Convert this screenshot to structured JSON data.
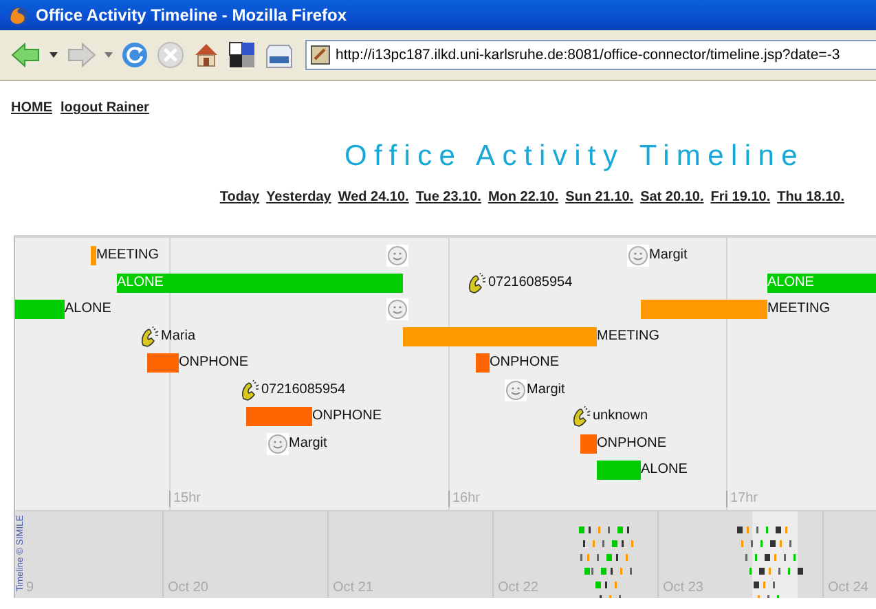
{
  "window": {
    "title": "Office Activity Timeline - Mozilla Firefox"
  },
  "toolbar": {
    "url": "http://i13pc187.ilkd.uni-karlsruhe.de:8081/office-connector/timeline.jsp?date=-3"
  },
  "nav_links": [
    "HOME",
    "logout Rainer"
  ],
  "heading": "Office Activity Timeline",
  "date_links": [
    "Today",
    "Yesterday",
    "Wed 24.10.",
    "Tue 23.10.",
    "Mon 22.10.",
    "Sun 21.10.",
    "Sat 20.10.",
    "Fri 19.10.",
    "Thu 18.10."
  ],
  "timeline": {
    "hour_ticks": [
      "15hr",
      "16hr",
      "17hr"
    ],
    "events": [
      {
        "kind": "duration",
        "label": "MEETING",
        "color": "#ff9900",
        "label_inside": false
      },
      {
        "kind": "visitor"
      },
      {
        "kind": "visitor",
        "label": "Margit"
      },
      {
        "kind": "duration",
        "label": "ALONE",
        "color": "#00cc00",
        "label_inside": true
      },
      {
        "kind": "call",
        "label": "07216085954"
      },
      {
        "kind": "duration",
        "label": "ALONE",
        "color": "#00cc00",
        "label_inside": true
      },
      {
        "kind": "duration",
        "label": "ALONE",
        "color": "#00cc00",
        "label_inside": false
      },
      {
        "kind": "visitor"
      },
      {
        "kind": "duration",
        "label": "MEETING",
        "color": "#ff9900",
        "label_inside": false
      },
      {
        "kind": "call",
        "label": "Maria"
      },
      {
        "kind": "duration",
        "label": "MEETING",
        "color": "#ff9900",
        "label_inside": false
      },
      {
        "kind": "duration",
        "label": "ONPHONE",
        "color": "#ff6600",
        "label_inside": false
      },
      {
        "kind": "duration",
        "label": "ONPHONE",
        "color": "#ff6600",
        "label_inside": false
      },
      {
        "kind": "call",
        "label": "07216085954"
      },
      {
        "kind": "visitor",
        "label": "Margit"
      },
      {
        "kind": "duration",
        "label": "ONPHONE",
        "color": "#ff6600",
        "label_inside": false
      },
      {
        "kind": "call",
        "label": "unknown"
      },
      {
        "kind": "visitor",
        "label": "Margit"
      },
      {
        "kind": "duration",
        "label": "ONPHONE",
        "color": "#ff6600",
        "label_inside": false
      },
      {
        "kind": "duration",
        "label": "ALONE",
        "color": "#00cc00",
        "label_inside": false
      }
    ],
    "overview_ticks": [
      "9",
      "Oct 20",
      "Oct 21",
      "Oct 22",
      "Oct 23",
      "Oct 24"
    ],
    "credit": "Timeline © SIMILE"
  }
}
